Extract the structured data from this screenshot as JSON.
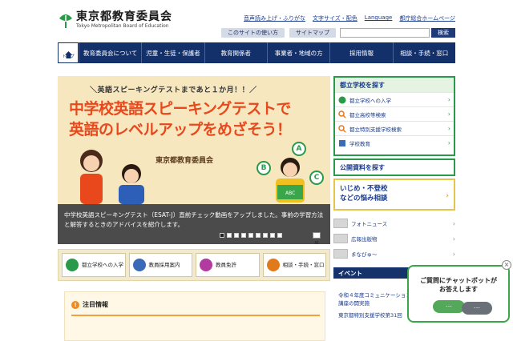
{
  "header": {
    "logo_jp": "東京都教育委員会",
    "logo_en": "Tokyo Metropolitan Board of Education",
    "util_links": [
      "音声読み上げ・ふりがな",
      "文字サイズ・配色",
      "Language",
      "都庁総合ホームページ"
    ],
    "pills": [
      "このサイトの使い方",
      "サイトマップ"
    ],
    "search_placeholder": "",
    "search_button": "検索"
  },
  "nav": {
    "home_label": "トップ",
    "items": [
      "教育委員会について",
      "児童・生徒・保護者",
      "教育関係者",
      "事業者・地域の方",
      "採用情報",
      "相談・手続・窓口"
    ]
  },
  "banner": {
    "sub": "＼英語スピーキングテストまであと１か月！！／",
    "headline1": "中学校英語スピーキングテストで",
    "headline2": "英語のレベルアップをめざそう！",
    "org": "東京都教育委員会",
    "bubbles": [
      "A",
      "B",
      "C"
    ],
    "book_label": "ABC",
    "caption": "中学校英語スピーキングテスト（ESAT-J）直前チェック動画をアップしました。事前の学習方法と解答するときのアドバイスを紹介します。",
    "slide_count": 9,
    "active_slide": 1
  },
  "quick_links": [
    {
      "label": "都立学校への入学",
      "color": "#2a9a4a"
    },
    {
      "label": "教員採用案内",
      "color": "#3a6ab8"
    },
    {
      "label": "教員免許",
      "color": "#b23aa0"
    },
    {
      "label": "相談・手続・窓口",
      "color": "#e07a1a"
    }
  ],
  "notice": {
    "icon": "!",
    "title": "注目情報"
  },
  "sidebar": {
    "school_search_title": "都立学校を探す",
    "school_links": [
      "都立学校への入学",
      "都立高校等検索",
      "都立特別支援学校検索",
      "学校教育"
    ],
    "public_docs": "公開資料を探す",
    "bullying_title_1": "いじめ・不登校",
    "bullying_title_2": "などの悩み相談",
    "media": [
      "フォトニュース",
      "広報出版物",
      "まなびゅ〜"
    ],
    "event_title": "イベント",
    "event_lines": [
      "令和４年度コミュニケーション",
      "講座の開実施",
      "東京都特別支援学校第31回"
    ]
  },
  "chatbot": {
    "line1": "ご質問にチャットボットが",
    "line2": "お答えします",
    "dots": "…",
    "close": "×"
  }
}
